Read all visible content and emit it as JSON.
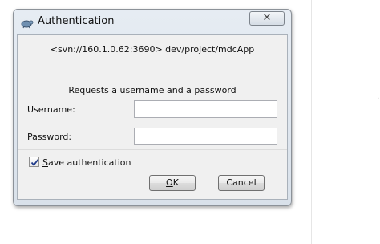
{
  "dialog": {
    "title": "Authentication",
    "close_glyph": "✕",
    "realm": "<svn://160.1.0.62:3690> dev/project/mdcApp",
    "prompt": "Requests a username and a password",
    "username_label": "Username:",
    "password_label": "Password:",
    "username_value": "",
    "password_value": "",
    "save_auth": {
      "mnemonic": "S",
      "rest": "ave authentication",
      "checked": true
    },
    "ok": {
      "mnemonic": "O",
      "rest": "K"
    },
    "cancel_label": "Cancel"
  },
  "icons": {
    "title_icon": "tortoise-icon",
    "close": "close-icon",
    "check": "checkmark-icon"
  },
  "colors": {
    "frame": "#d9e1ea",
    "client": "#f0f0f0",
    "checkmark": "#1f3a8a"
  }
}
